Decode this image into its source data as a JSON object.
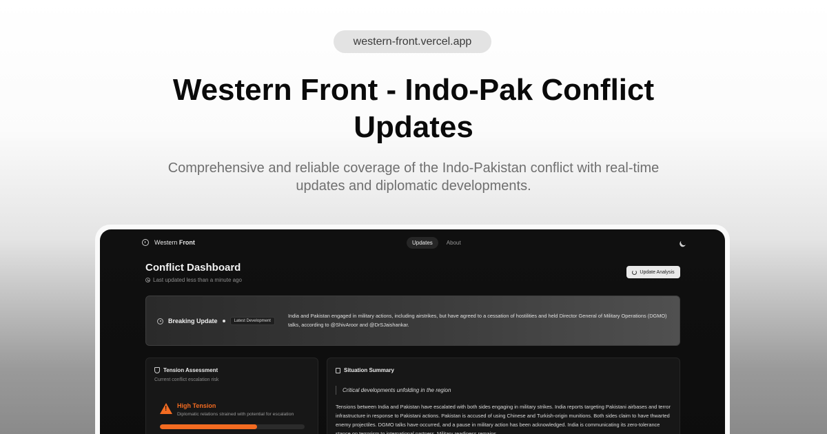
{
  "url": "western-front.vercel.app",
  "hero": {
    "title": "Western Front - Indo-Pak Conflict Updates",
    "subtitle": "Comprehensive and reliable coverage of the Indo-Pakistan conflict with real-time updates and diplomatic developments."
  },
  "app": {
    "brand_prefix": "Western",
    "brand_suffix": "Front",
    "tabs": [
      {
        "label": "Updates",
        "active": true
      },
      {
        "label": "About",
        "active": false
      }
    ],
    "dashboard": {
      "title": "Conflict Dashboard",
      "last_updated": "Last updated less than a minute ago",
      "update_button": "Update Analysis"
    },
    "breaking": {
      "label": "Breaking Update",
      "badge": "Latest Development",
      "text": "India and Pakistan engaged in military actions, including airstrikes, but have agreed to a cessation of hostilities and held Director General of Military Operations (DGMO) talks, according to @ShivAroor and @DrSJaishankar."
    },
    "tension": {
      "title": "Tension Assessment",
      "subtitle": "Current conflict escalation risk",
      "level": "High Tension",
      "description": "Diplomatic relations strained with potential for escalation",
      "progress_percent": 67
    },
    "summary": {
      "title": "Situation Summary",
      "quote": "Critical developments unfolding in the region",
      "text": "Tensions between India and Pakistan have escalated with both sides engaging in military strikes. India reports targeting Pakistani airbases and terror infrastructure in response to Pakistani actions. Pakistan is accused of using Chinese and Turkish-origin munitions. Both sides claim to have thwarted enemy projectiles. DGMO talks have occurred, and a pause in military action has been acknowledged. India is communicating its zero-tolerance stance on terrorism to international partners. Military readiness remains"
    }
  },
  "colors": {
    "accent_orange": "#f36b21",
    "screen_bg": "#0d0d0d"
  }
}
